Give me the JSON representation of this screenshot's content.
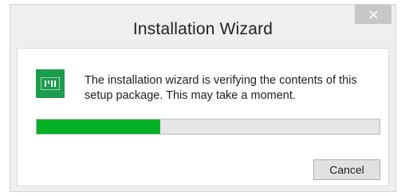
{
  "window": {
    "title": "Installation Wizard",
    "close_icon": "close-icon"
  },
  "dialog": {
    "icon": "installer-icon",
    "message": "The installation wizard is verifying the contents of this setup package. This may take a moment.",
    "progress": 0.36,
    "cancel_label": "Cancel"
  },
  "colors": {
    "icon_background": "#1c9c4e",
    "progress_fill": "#06b025",
    "close_button": "#c7c7c7"
  }
}
